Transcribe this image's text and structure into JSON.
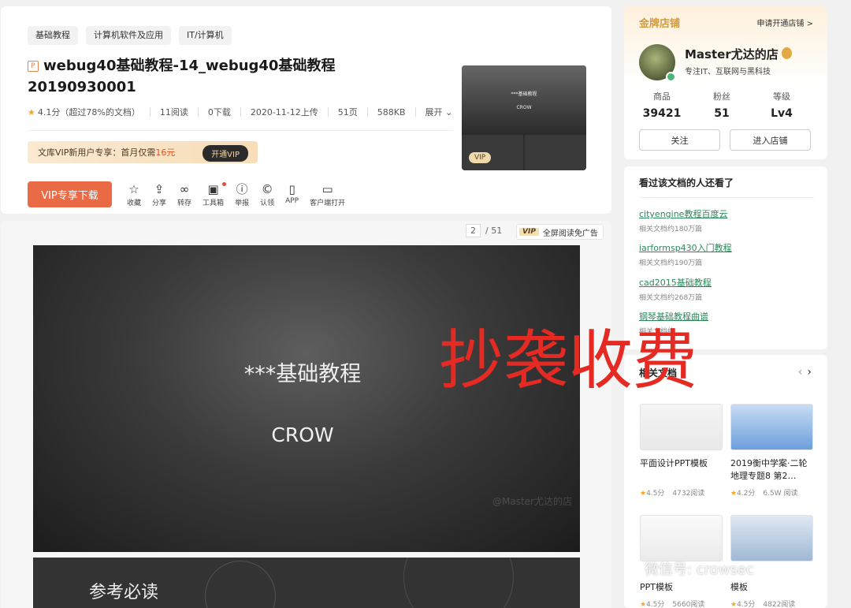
{
  "tags": [
    "基础教程",
    "计算机软件及应用",
    "IT/计算机"
  ],
  "doc": {
    "type_icon": "P",
    "title": "webug40基础教程-14_webug40基础教程20190930001",
    "rating": "4.1分（超过78%的文档）",
    "reads": "11阅读",
    "downloads": "0下载",
    "uploaded": "2020-11-12上传",
    "pages": "51页",
    "size": "588KB",
    "expand": "展开"
  },
  "vip_banner": {
    "text": "文库VIP新用户专享：首月仅需",
    "price": "16元",
    "button": "开通VIP"
  },
  "download_button": "VIP专享下载",
  "tools": [
    {
      "label": "收藏",
      "icon": "star-icon"
    },
    {
      "label": "分享",
      "icon": "share-icon"
    },
    {
      "label": "转存",
      "icon": "save-to-icon"
    },
    {
      "label": "工具箱",
      "icon": "toolbox-icon"
    },
    {
      "label": "举报",
      "icon": "report-icon"
    },
    {
      "label": "认领",
      "icon": "copyright-icon"
    },
    {
      "label": "APP",
      "icon": "phone-icon"
    },
    {
      "label": "客户端打开",
      "icon": "monitor-icon"
    }
  ],
  "thumbnail": {
    "title": "***基础教程",
    "subtitle": "CROW",
    "vip_badge": "VIP"
  },
  "viewer": {
    "current_page": "2",
    "total_pages": "/ 51",
    "vip_badge": "VIP",
    "fullscreen_label": "全屏阅读免广告",
    "slide1_title": "***基础教程",
    "slide1_subtitle": "CROW",
    "slide1_watermark": "@Master尤达的店",
    "slide2_title": "参考必读"
  },
  "overlay_text": "抄袭收费",
  "shop": {
    "gold_label": "金牌店铺",
    "apply_label": "申请开通店铺 >",
    "name": "Master尤达的店",
    "description": "专注IT、互联网与黑科技",
    "stats": [
      {
        "label": "商品",
        "value": "39421"
      },
      {
        "label": "粉丝",
        "value": "51"
      },
      {
        "label": "等级",
        "value": "Lv4"
      }
    ],
    "follow_button": "关注",
    "enter_button": "进入店铺"
  },
  "also_viewed": {
    "title": "看过该文档的人还看了",
    "items": [
      {
        "title": "cityengine教程百度云",
        "count": "相关文档约180万篇"
      },
      {
        "title": "iarformsp430入门教程",
        "count": "相关文档约190万篇"
      },
      {
        "title": "cad2015基础教程",
        "count": "相关文档约268万篇"
      },
      {
        "title": "钢琴基础教程曲谱",
        "count": "相关文档约"
      }
    ]
  },
  "related": {
    "title": "相关文档",
    "items": [
      {
        "title": "平面设计PPT模板",
        "rating": "4.5分",
        "reads": "4732阅读"
      },
      {
        "title": "2019衡中学案·二轮地理专题8 第2…",
        "rating": "4.2分",
        "reads": "6.5W 阅读"
      },
      {
        "title": "PPT模板",
        "rating": "4.5分",
        "reads": "5660阅读"
      },
      {
        "title": "模板",
        "rating": "4.5分",
        "reads": "4822阅读"
      }
    ]
  },
  "wechat_watermark": "微信号: crowsec"
}
